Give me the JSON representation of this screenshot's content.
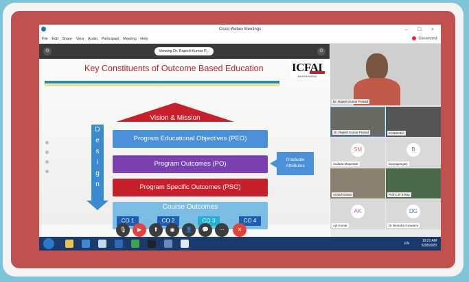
{
  "window": {
    "title": "Cisco Webex Meetings",
    "controls": "–  ☐  ×",
    "connected": "Connected"
  },
  "menu": [
    "File",
    "Edit",
    "Share",
    "View",
    "Audio",
    "Participant",
    "Meeting",
    "Help"
  ],
  "share": {
    "viewing": "Viewing Dr. Rajesh Kumar P...",
    "icon_left": "⊙",
    "icon_right": "⊙"
  },
  "slide": {
    "title": "Key Constituents of Outcome Based Education",
    "logo_text": "ICFAI",
    "logo_sub": "JHARKHAND",
    "vision": "Vision & Mission",
    "peo": "Program Educational Objectives (PEO)",
    "po": "Program Outcomes (PO)",
    "pso": "Program Specific Outcomes (PSO)",
    "course_outcomes": "Course Outcomes",
    "co": [
      "CO 1",
      "CO 2",
      "CO 3",
      "CO 4"
    ],
    "graduate_line1": "Graduate",
    "graduate_line2": "Attributes",
    "design_letters": [
      "D",
      "e",
      "s",
      "i",
      "g",
      "n"
    ],
    "colors": {
      "blue": "#4a90d9",
      "purple": "#7a3fb0",
      "red": "#c8202a",
      "co_blue": "#1a5fb4",
      "co_cyan": "#22b0d6"
    }
  },
  "controls": {
    "icons": [
      "mic-icon",
      "video-icon",
      "share-icon",
      "record-icon",
      "participants-icon",
      "chat-icon",
      "more-icon",
      "end-call-icon"
    ],
    "glyphs": [
      "🎙",
      "▶",
      "⬆",
      "◉",
      "👤",
      "💬",
      "⋯",
      "✕"
    ]
  },
  "participants": [
    {
      "name": "Dr. Rajesh Kumar Prasad"
    },
    {
      "name": "Dr. Rajesh Kumar Prasad"
    },
    {
      "name": "KANISHKA"
    },
    {
      "name": "Sudipta Majumdar",
      "initials": "SM"
    },
    {
      "name": "bijoyaganguly",
      "initials": "B"
    },
    {
      "name": "Arvind Kumar"
    },
    {
      "name": "Prof C R S Ray"
    },
    {
      "name": "Ajit Kumar",
      "initials": "AK"
    },
    {
      "name": "Dr Birendra Goswami",
      "initials": "DG"
    }
  ],
  "taskbar": {
    "lang": "EN",
    "time": "10:21 AM",
    "date": "5/28/2020"
  }
}
